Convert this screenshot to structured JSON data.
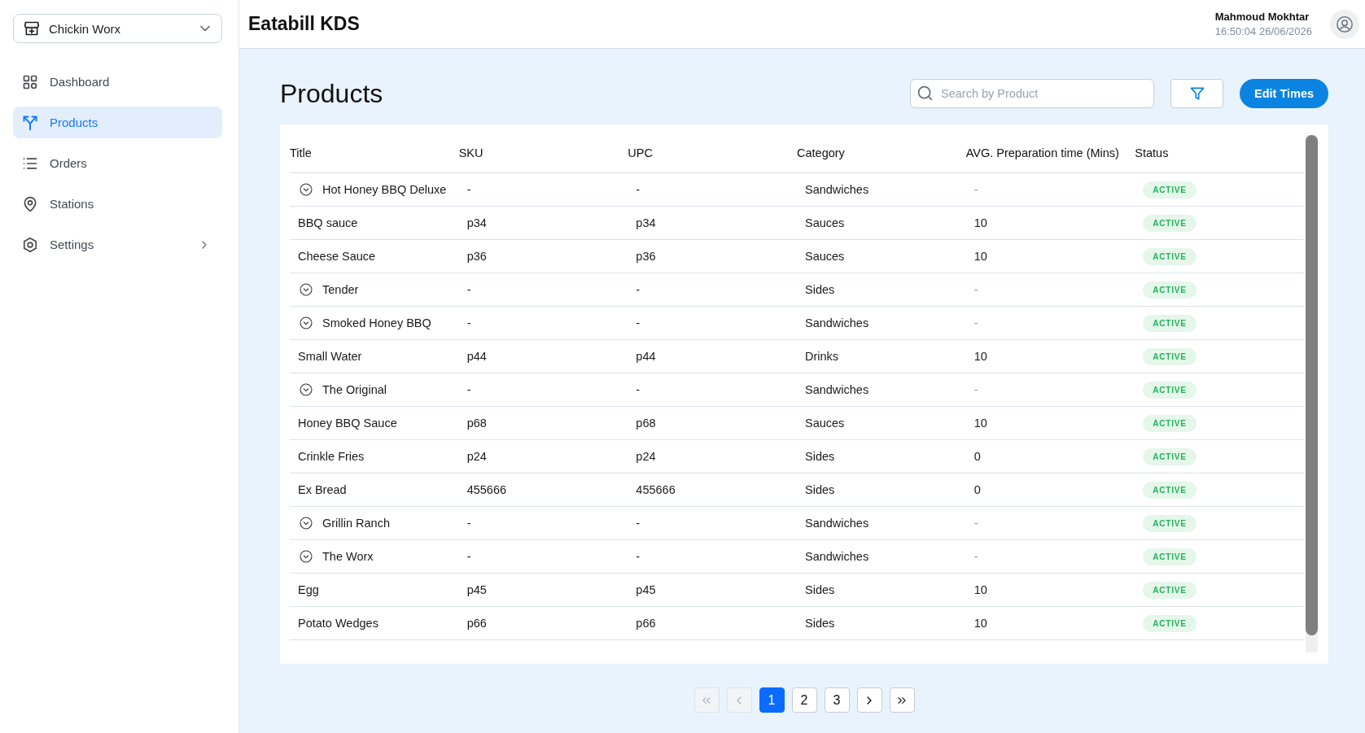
{
  "sidebar": {
    "store_select": {
      "value": "Chickin Worx"
    },
    "nav_items": [
      {
        "label": "Dashboard",
        "selected": false,
        "kind": "link"
      },
      {
        "label": "Products",
        "selected": true,
        "kind": "link"
      },
      {
        "label": "Orders",
        "selected": false,
        "kind": "link"
      },
      {
        "label": "Stations",
        "selected": false,
        "kind": "link"
      },
      {
        "label": "Settings",
        "selected": false,
        "kind": "group"
      }
    ]
  },
  "header": {
    "app_title": "Eatabill KDS",
    "user": {
      "name": "Mahmoud Mokhtar",
      "timestamp": "16:50:04 26/06/2026"
    }
  },
  "page": {
    "title": "Products",
    "search": {
      "placeholder": "Search by Product"
    },
    "edit_button": "Edit Times"
  },
  "table": {
    "columns": [
      "Title",
      "SKU",
      "UPC",
      "Category",
      "AVG. Preparation time (Mins)",
      "Status"
    ],
    "rows": [
      {
        "kind": "bundle",
        "title": "Hot Honey BBQ Deluxe",
        "sku": "-",
        "upc": "-",
        "category": "Sandwiches",
        "avg_time": "-",
        "status": "ACTIVE"
      },
      {
        "kind": "item",
        "title": "BBQ sauce",
        "sku": "p34",
        "upc": "p34",
        "category": "Sauces",
        "avg_time": "10",
        "status": "ACTIVE"
      },
      {
        "kind": "item",
        "title": "Cheese Sauce",
        "sku": "p36",
        "upc": "p36",
        "category": "Sauces",
        "avg_time": "10",
        "status": "ACTIVE"
      },
      {
        "kind": "bundle",
        "title": "Tender",
        "sku": "-",
        "upc": "-",
        "category": "Sides",
        "avg_time": "-",
        "status": "ACTIVE"
      },
      {
        "kind": "bundle",
        "title": "Smoked Honey BBQ",
        "sku": "-",
        "upc": "-",
        "category": "Sandwiches",
        "avg_time": "-",
        "status": "ACTIVE"
      },
      {
        "kind": "item",
        "title": "Small Water",
        "sku": "p44",
        "upc": "p44",
        "category": "Drinks",
        "avg_time": "10",
        "status": "ACTIVE"
      },
      {
        "kind": "bundle",
        "title": "The Original",
        "sku": "-",
        "upc": "-",
        "category": "Sandwiches",
        "avg_time": "-",
        "status": "ACTIVE"
      },
      {
        "kind": "item",
        "title": "Honey BBQ Sauce",
        "sku": "p68",
        "upc": "p68",
        "category": "Sauces",
        "avg_time": "10",
        "status": "ACTIVE"
      },
      {
        "kind": "item",
        "title": "Crinkle Fries",
        "sku": "p24",
        "upc": "p24",
        "category": "Sides",
        "avg_time": "0",
        "status": "ACTIVE"
      },
      {
        "kind": "item",
        "title": "Ex Bread",
        "sku": "455666",
        "upc": "455666",
        "category": "Sides",
        "avg_time": "0",
        "status": "ACTIVE"
      },
      {
        "kind": "bundle",
        "title": "Grillin Ranch",
        "sku": "-",
        "upc": "-",
        "category": "Sandwiches",
        "avg_time": "-",
        "status": "ACTIVE"
      },
      {
        "kind": "bundle",
        "title": "The Worx",
        "sku": "-",
        "upc": "-",
        "category": "Sandwiches",
        "avg_time": "-",
        "status": "ACTIVE"
      },
      {
        "kind": "item",
        "title": "Egg",
        "sku": "p45",
        "upc": "p45",
        "category": "Sides",
        "avg_time": "10",
        "status": "ACTIVE"
      },
      {
        "kind": "item",
        "title": "Potato Wedges",
        "sku": "p66",
        "upc": "p66",
        "category": "Sides",
        "avg_time": "10",
        "status": "ACTIVE"
      }
    ]
  },
  "pagination": {
    "first": {
      "disabled": true
    },
    "previous": {
      "disabled": true
    },
    "pages": [
      {
        "label": "1",
        "selected": true
      },
      {
        "label": "2",
        "selected": false
      },
      {
        "label": "3",
        "selected": false
      }
    ],
    "next": {
      "disabled": false
    },
    "last": {
      "disabled": false
    }
  }
}
